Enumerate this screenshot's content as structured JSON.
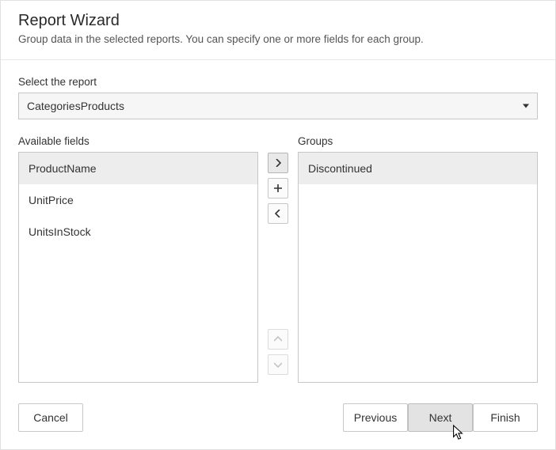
{
  "header": {
    "title": "Report Wizard",
    "subtitle": "Group data in the selected reports. You can specify one or more fields for each group."
  },
  "reportSelect": {
    "label": "Select the report",
    "value": "CategoriesProducts"
  },
  "available": {
    "label": "Available fields",
    "items": [
      "ProductName",
      "UnitPrice",
      "UnitsInStock"
    ],
    "selectedIndex": 0
  },
  "groups": {
    "label": "Groups",
    "items": [
      "Discontinued"
    ],
    "selectedIndex": 0
  },
  "mover": {
    "add": ">",
    "addAll": "+",
    "remove": "<",
    "up": "^",
    "down": "v"
  },
  "footer": {
    "cancel": "Cancel",
    "previous": "Previous",
    "next": "Next",
    "finish": "Finish"
  }
}
